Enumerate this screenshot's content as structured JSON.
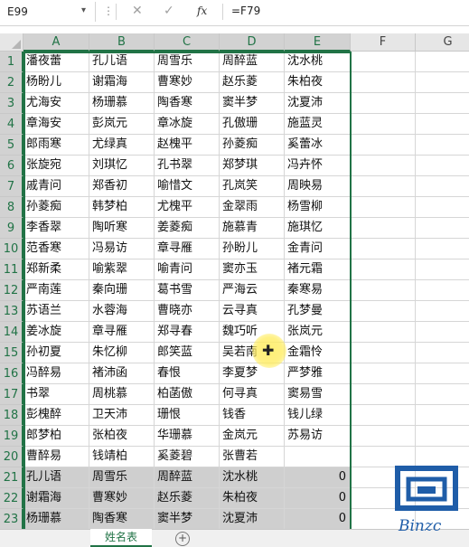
{
  "formula_bar": {
    "name_box": "E99",
    "cancel_glyph": "✕",
    "confirm_glyph": "✓",
    "fx_label": "fx",
    "formula": "=F79"
  },
  "columns": [
    "A",
    "B",
    "C",
    "D",
    "E",
    "F",
    "G"
  ],
  "selected_columns": [
    "A",
    "B",
    "C",
    "D",
    "E"
  ],
  "rows": [
    {
      "n": "1",
      "cells": [
        "潘夜蕾",
        "孔儿语",
        "周雪乐",
        "周醉蓝",
        "沈水桃"
      ]
    },
    {
      "n": "2",
      "cells": [
        "杨盼儿",
        "谢霜海",
        "曹寒妙",
        "赵乐菱",
        "朱柏夜"
      ]
    },
    {
      "n": "3",
      "cells": [
        "尤海安",
        "杨珊慕",
        "陶香寒",
        "窦半梦",
        "沈夏沛"
      ]
    },
    {
      "n": "4",
      "cells": [
        "章海安",
        "彭岚元",
        "章冰旋",
        "孔傲珊",
        "施蓝灵"
      ]
    },
    {
      "n": "5",
      "cells": [
        "郎雨寒",
        "尤绿真",
        "赵槐平",
        "孙菱痴",
        "奚蕾冰"
      ]
    },
    {
      "n": "6",
      "cells": [
        "张旋宛",
        "刘琪忆",
        "孔书翠",
        "郑梦琪",
        "冯卉怀"
      ]
    },
    {
      "n": "7",
      "cells": [
        "戚青问",
        "郑香初",
        "喻惜文",
        "孔岚笑",
        "周映易"
      ]
    },
    {
      "n": "8",
      "cells": [
        "孙菱痴",
        "韩梦柏",
        "尤槐平",
        "金翠雨",
        "杨雪柳"
      ]
    },
    {
      "n": "9",
      "cells": [
        "李香翠",
        "陶听寒",
        "姜菱痴",
        "施慕青",
        "施琪忆"
      ]
    },
    {
      "n": "10",
      "cells": [
        "范香寒",
        "冯易访",
        "章寻雁",
        "孙盼儿",
        "金青问"
      ]
    },
    {
      "n": "11",
      "cells": [
        "郑新柔",
        "喻紫翠",
        "喻青问",
        "窦亦玉",
        "褚元霜"
      ]
    },
    {
      "n": "12",
      "cells": [
        "严南莲",
        "秦向珊",
        "葛书雪",
        "严海云",
        "秦寒易"
      ]
    },
    {
      "n": "13",
      "cells": [
        "苏语兰",
        "水蓉海",
        "曹晓亦",
        "云寻真",
        "孔梦曼"
      ]
    },
    {
      "n": "14",
      "cells": [
        "姜冰旋",
        "章寻雁",
        "郑寻春",
        "魏巧听",
        "张岚元"
      ]
    },
    {
      "n": "15",
      "cells": [
        "孙初夏",
        "朱忆柳",
        "郎笑蓝",
        "吴若南",
        "金霜怜"
      ]
    },
    {
      "n": "16",
      "cells": [
        "冯醉易",
        "褚沛函",
        "春恨",
        "李夏梦",
        "严梦雅"
      ]
    },
    {
      "n": "17",
      "cells": [
        "书翠",
        "周桃慕",
        "柏菡傲",
        "何寻真",
        "窦易雪"
      ]
    },
    {
      "n": "18",
      "cells": [
        "彭槐醉",
        "卫天沛",
        "珊恨",
        "钱香",
        "钱儿绿"
      ]
    },
    {
      "n": "19",
      "cells": [
        "郎梦柏",
        "张柏夜",
        "华珊慕",
        "金岚元",
        "苏易访"
      ]
    },
    {
      "n": "20",
      "cells": [
        "曹醉易",
        "钱靖柏",
        "奚菱碧",
        "张曹若",
        ""
      ]
    },
    {
      "n": "21",
      "cells": [
        "孔儿语",
        "周雪乐",
        "周醉蓝",
        "沈水桃",
        "0"
      ]
    },
    {
      "n": "22",
      "cells": [
        "谢霜海",
        "曹寒妙",
        "赵乐菱",
        "朱柏夜",
        "0"
      ]
    },
    {
      "n": "23",
      "cells": [
        "杨珊慕",
        "陶香寒",
        "窦半梦",
        "沈夏沛",
        "0"
      ]
    },
    {
      "n": "24",
      "cells": [
        "彭岚元",
        "章冰旋",
        "孔傲珊",
        "施蓝灵",
        "0"
      ]
    }
  ],
  "sheet_tab": "姓名表",
  "add_sheet_glyph": "+",
  "logo_text": "Binzc",
  "colors": {
    "accent_green": "#217346",
    "header_bg": "#e6e6e6",
    "shade": "#cfcfcf",
    "logo_blue": "#1f5da8"
  }
}
